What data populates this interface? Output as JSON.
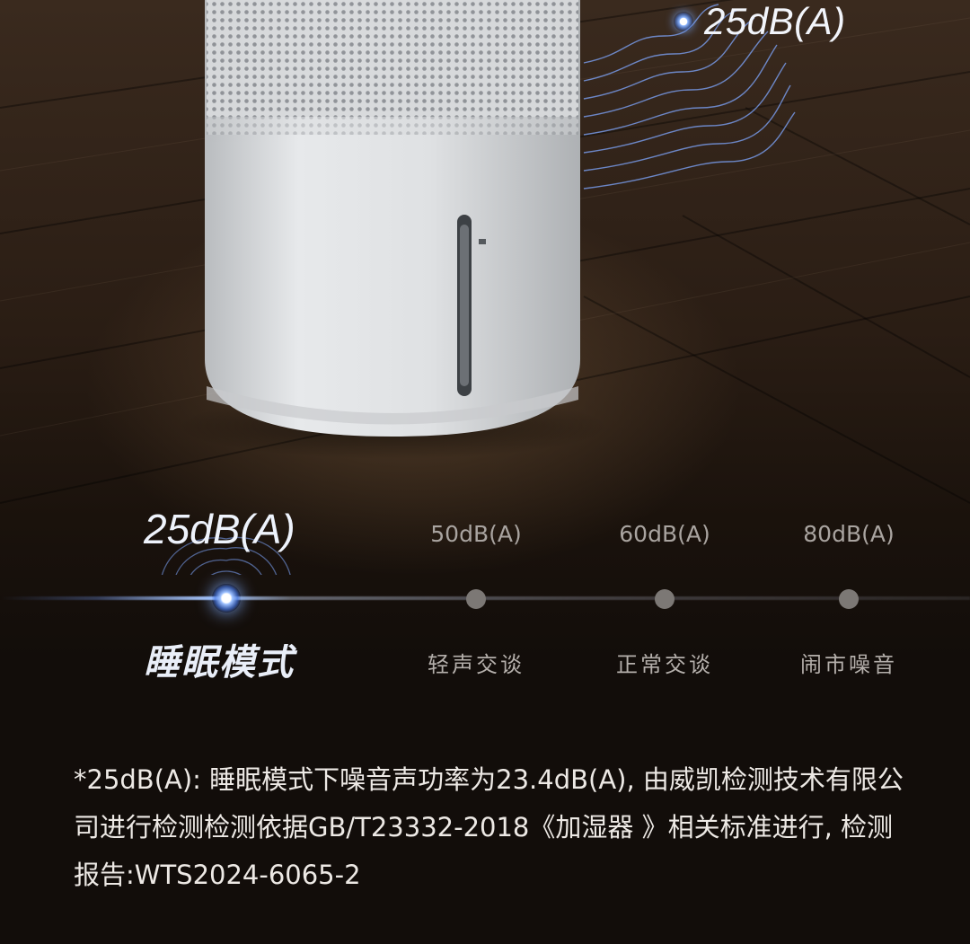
{
  "hero": {
    "top_level": "25dB(A)"
  },
  "scale": {
    "active": {
      "db": "25dB(A)",
      "mode": "睡眠模式"
    },
    "levels": [
      {
        "db": "50dB(A)",
        "name": "轻声交谈"
      },
      {
        "db": "60dB(A)",
        "name": "正常交谈"
      },
      {
        "db": "80dB(A)",
        "name": "闹市噪音"
      }
    ]
  },
  "footnote": {
    "text": "*25dB(A): 睡眠模式下噪音声功率为23.4dB(A), 由威凯检测技术有限公司进行检测检测依据GB/T23332-2018《加湿器 》相关标准进行, 检测报告:WTS2024-6065-2"
  },
  "colors": {
    "accent_glow": "#9cc0ff",
    "background": "#120d0a",
    "device_body": "#e4e6e8"
  }
}
